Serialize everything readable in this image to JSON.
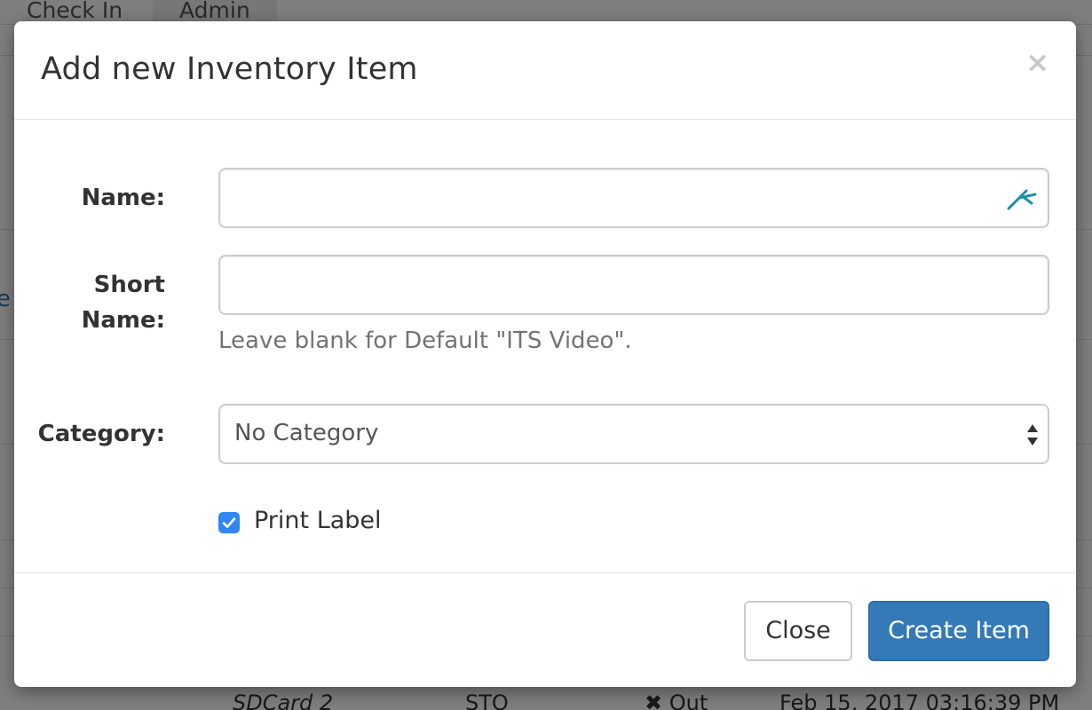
{
  "background": {
    "nav_tabs": [
      "Check In",
      "Admin"
    ],
    "side_letter": "e",
    "bottom_row": {
      "name": "SDCard 2",
      "dept": "STO",
      "status": "✖ Out",
      "date": "Feb 15, 2017 03:16:39 PM"
    }
  },
  "modal": {
    "title": "Add new Inventory Item",
    "close_symbol": "×",
    "fields": {
      "name_label": "Name:",
      "name_value": "",
      "short_name_label_line1": "Short",
      "short_name_label_line2": "Name:",
      "short_name_value": "",
      "short_name_help": "Leave blank for Default \"ITS Video\".",
      "category_label": "Category:",
      "category_selected": "No Category",
      "print_label_text": "Print Label",
      "print_label_checked": true
    },
    "footer": {
      "close_label": "Close",
      "create_label": "Create Item"
    }
  },
  "colors": {
    "primary": "#337ab7",
    "checkbox": "#2f87f0",
    "autofill_icon": "#1e8fa8"
  },
  "icons": {
    "close": "close-icon",
    "autofill": "password-manager-icon",
    "select_arrows": "updown-arrows-icon",
    "checkmark": "checkmark-icon"
  }
}
